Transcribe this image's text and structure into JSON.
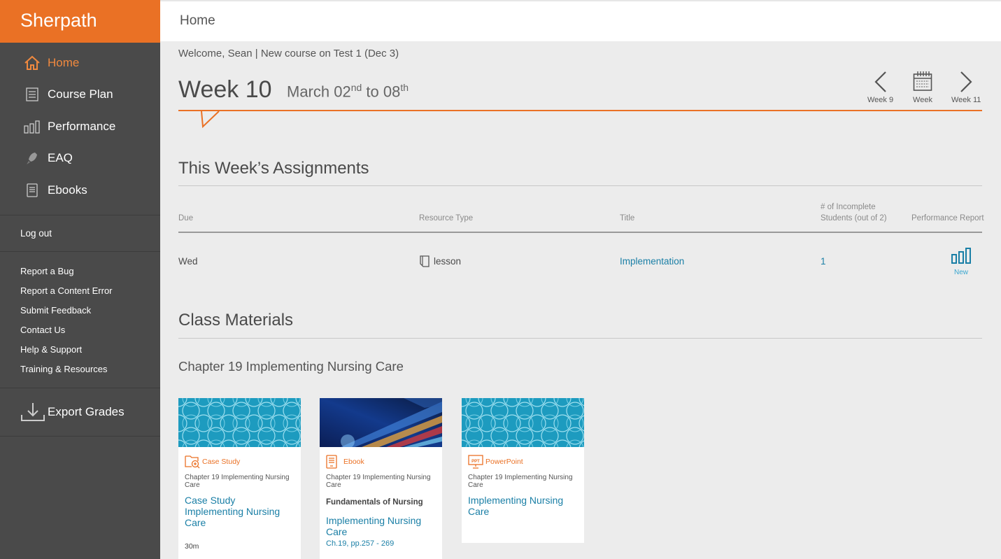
{
  "sidebar": {
    "brand": "Sherpath",
    "nav": [
      {
        "label": "Home",
        "icon": "home-icon",
        "active": true
      },
      {
        "label": "Course Plan",
        "icon": "list-icon"
      },
      {
        "label": "Performance",
        "icon": "bar-chart-icon"
      },
      {
        "label": "EAQ",
        "icon": "rocket-icon"
      },
      {
        "label": "Ebooks",
        "icon": "ebook-icon"
      }
    ],
    "logout": "Log out",
    "links": [
      "Report a Bug",
      "Report a Content Error",
      "Submit Feedback",
      "Contact Us",
      "Help & Support",
      "Training & Resources"
    ],
    "export": "Export Grades"
  },
  "header": {
    "title": "Home"
  },
  "welcome": "Welcome, Sean | New course on Test 1 (Dec 3)",
  "week": {
    "title": "Week 10",
    "range_prefix": "March 02",
    "range_sup1": "nd",
    "range_mid": " to 08",
    "range_sup2": "th",
    "prev_label": "Week 9",
    "cal_label": "Week",
    "next_label": "Week 11"
  },
  "assignments": {
    "heading": "This Week’s Assignments",
    "columns": {
      "due": "Due",
      "type": "Resource Type",
      "title": "Title",
      "incomplete": "# of Incomplete Students (out of 2)",
      "report": "Performance Report"
    },
    "rows": [
      {
        "due": "Wed",
        "type": "lesson",
        "title": "Implementation",
        "incomplete": "1",
        "report_badge": "New"
      }
    ]
  },
  "materials": {
    "heading": "Class Materials",
    "chapter": "Chapter 19 Implementing Nursing Care",
    "cards": [
      {
        "type": "Case Study",
        "icon": "case-study-icon",
        "chapter": "Chapter 19 Implementing Nursing Care",
        "title": "Case Study Implementing Nursing Care",
        "meta": "30m"
      },
      {
        "type": "Ebook",
        "icon": "ebook-icon",
        "chapter": "Chapter 19 Implementing Nursing Care",
        "book": "Fundamentals of Nursing",
        "title": "Implementing Nursing Care",
        "pages": "Ch.19, pp.257 - 269"
      },
      {
        "type": "PowerPoint",
        "icon": "ppt-icon",
        "chapter": "Chapter 19 Implementing Nursing Care",
        "title": "Implementing Nursing Care"
      }
    ]
  },
  "colors": {
    "brand": "#ea7125",
    "sidebar": "#4a4a4a",
    "link": "#1a7fa6"
  }
}
